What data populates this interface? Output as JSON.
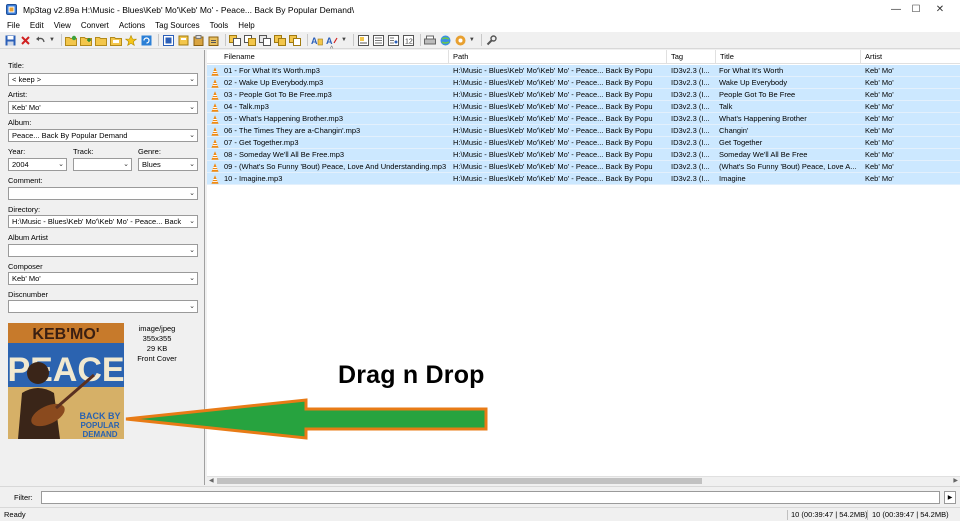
{
  "window": {
    "title": "Mp3tag v2.89a   H:\\Music - Blues\\Keb' Mo'\\Keb' Mo' - Peace... Back By Popular Demand\\",
    "minimize": "—",
    "maximize": "☐",
    "close": "✕"
  },
  "menu": [
    "File",
    "Edit",
    "View",
    "Convert",
    "Actions",
    "Tag Sources",
    "Tools",
    "Help"
  ],
  "tags": {
    "title_label": "Title:",
    "title_value": "< keep >",
    "artist_label": "Artist:",
    "artist_value": "Keb' Mo'",
    "album_label": "Album:",
    "album_value": "Peace... Back By Popular Demand",
    "year_label": "Year:",
    "year_value": "2004",
    "track_label": "Track:",
    "track_value": "",
    "genre_label": "Genre:",
    "genre_value": "Blues",
    "comment_label": "Comment:",
    "comment_value": "",
    "directory_label": "Directory:",
    "directory_value": "H:\\Music - Blues\\Keb' Mo'\\Keb' Mo' - Peace... Back",
    "album_artist_label": "Album Artist",
    "album_artist_value": "",
    "composer_label": "Composer",
    "composer_value": "Keb' Mo'",
    "discnumber_label": "Discnumber",
    "discnumber_value": ""
  },
  "cover": {
    "band_text": "KEB'MO'",
    "word_text": "PEACE",
    "sub1": "BACK BY",
    "sub2": "POPULAR",
    "sub3": "DEMAND",
    "mime": "image/jpeg",
    "dimensions": "355x355",
    "size": "29 KB",
    "type": "Front Cover"
  },
  "list": {
    "columns": [
      "Filename",
      "Path",
      "Tag",
      "Title",
      "Artist"
    ],
    "rows": [
      {
        "filename": "01 - For What It's Worth.mp3",
        "path": "H:\\Music - Blues\\Keb' Mo'\\Keb' Mo' - Peace... Back By Popu",
        "tag": "ID3v2.3 (I...",
        "title": "For What It's Worth",
        "artist": "Keb' Mo'"
      },
      {
        "filename": "02 - Wake Up Everybody.mp3",
        "path": "H:\\Music - Blues\\Keb' Mo'\\Keb' Mo' - Peace... Back By Popu",
        "tag": "ID3v2.3 (I...",
        "title": "Wake Up Everybody",
        "artist": "Keb' Mo'"
      },
      {
        "filename": "03 - People Got To Be Free.mp3",
        "path": "H:\\Music - Blues\\Keb' Mo'\\Keb' Mo' - Peace... Back By Popu",
        "tag": "ID3v2.3 (I...",
        "title": "People Got To Be Free",
        "artist": "Keb' Mo'"
      },
      {
        "filename": "04 - Talk.mp3",
        "path": "H:\\Music - Blues\\Keb' Mo'\\Keb' Mo' - Peace... Back By Popu",
        "tag": "ID3v2.3 (I...",
        "title": "Talk",
        "artist": "Keb' Mo'"
      },
      {
        "filename": "05 - What's Happening Brother.mp3",
        "path": "H:\\Music - Blues\\Keb' Mo'\\Keb' Mo' - Peace... Back By Popu",
        "tag": "ID3v2.3 (I...",
        "title": "What's Happening Brother",
        "artist": "Keb' Mo'"
      },
      {
        "filename": "06 - The Times They are a-Changin'.mp3",
        "path": "H:\\Music - Blues\\Keb' Mo'\\Keb' Mo' - Peace... Back By Popu",
        "tag": "ID3v2.3 (I...",
        "title": "Changin'",
        "artist": "Keb' Mo'"
      },
      {
        "filename": "07 - Get Together.mp3",
        "path": "H:\\Music - Blues\\Keb' Mo'\\Keb' Mo' - Peace... Back By Popu",
        "tag": "ID3v2.3 (I...",
        "title": "Get Together",
        "artist": "Keb' Mo'"
      },
      {
        "filename": "08 - Someday We'll All Be Free.mp3",
        "path": "H:\\Music - Blues\\Keb' Mo'\\Keb' Mo' - Peace... Back By Popu",
        "tag": "ID3v2.3 (I...",
        "title": "Someday We'll All Be Free",
        "artist": "Keb' Mo'"
      },
      {
        "filename": "09 - (What's So Funny 'Bout) Peace, Love And Understanding.mp3",
        "path": "H:\\Music - Blues\\Keb' Mo'\\Keb' Mo' - Peace... Back By Popu",
        "tag": "ID3v2.3 (I...",
        "title": "(What's So Funny 'Bout) Peace, Love A...",
        "artist": "Keb' Mo'"
      },
      {
        "filename": "10 - Imagine.mp3",
        "path": "H:\\Music - Blues\\Keb' Mo'\\Keb' Mo' - Peace... Back By Popu",
        "tag": "ID3v2.3 (I...",
        "title": "Imagine",
        "artist": "Keb' Mo'"
      }
    ]
  },
  "annotation": {
    "text": "Drag n Drop"
  },
  "filter": {
    "label": "Filter:",
    "value": "",
    "go": "▶"
  },
  "status": {
    "ready": "Ready",
    "selected": "10 (00:39:47 | 54.2MB)",
    "total": "10 (00:39:47 | 54.2MB)"
  },
  "colors": {
    "selection": "#cce8ff",
    "arrow_fill": "#27a33f",
    "arrow_outline": "#e87b16"
  }
}
